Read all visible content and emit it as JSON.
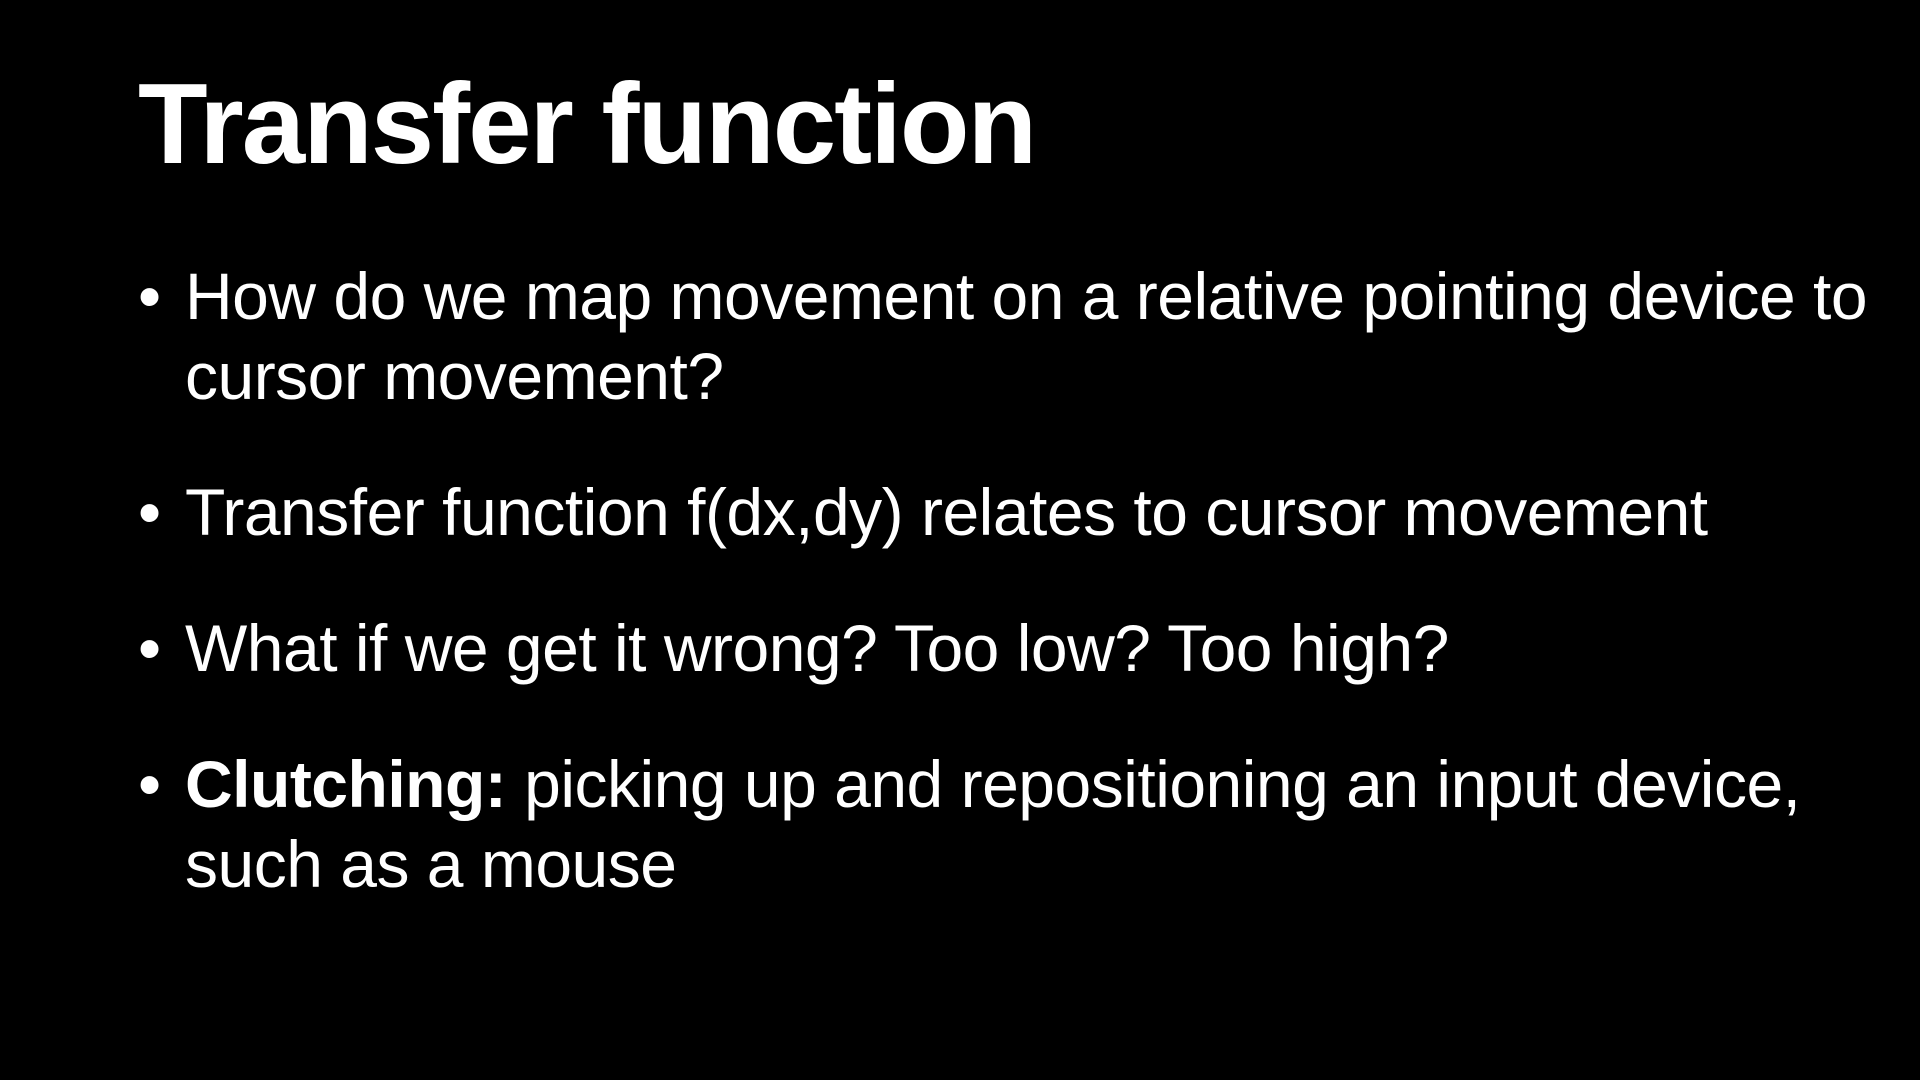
{
  "slide": {
    "title": "Transfer function",
    "bullet_glyph": "•",
    "bullets": [
      {
        "term": "",
        "text": "How do we map movement on a relative pointing device to cursor movement?"
      },
      {
        "term": "",
        "text": "Transfer function f(dx,dy) relates to cursor movement"
      },
      {
        "term": "",
        "text": "What if we get it wrong? Too low? Too high?"
      },
      {
        "term": "Clutching:",
        "text": "picking up and repositioning an input device, such as a mouse"
      }
    ]
  },
  "colors": {
    "background": "#000000",
    "text": "#ffffff"
  }
}
